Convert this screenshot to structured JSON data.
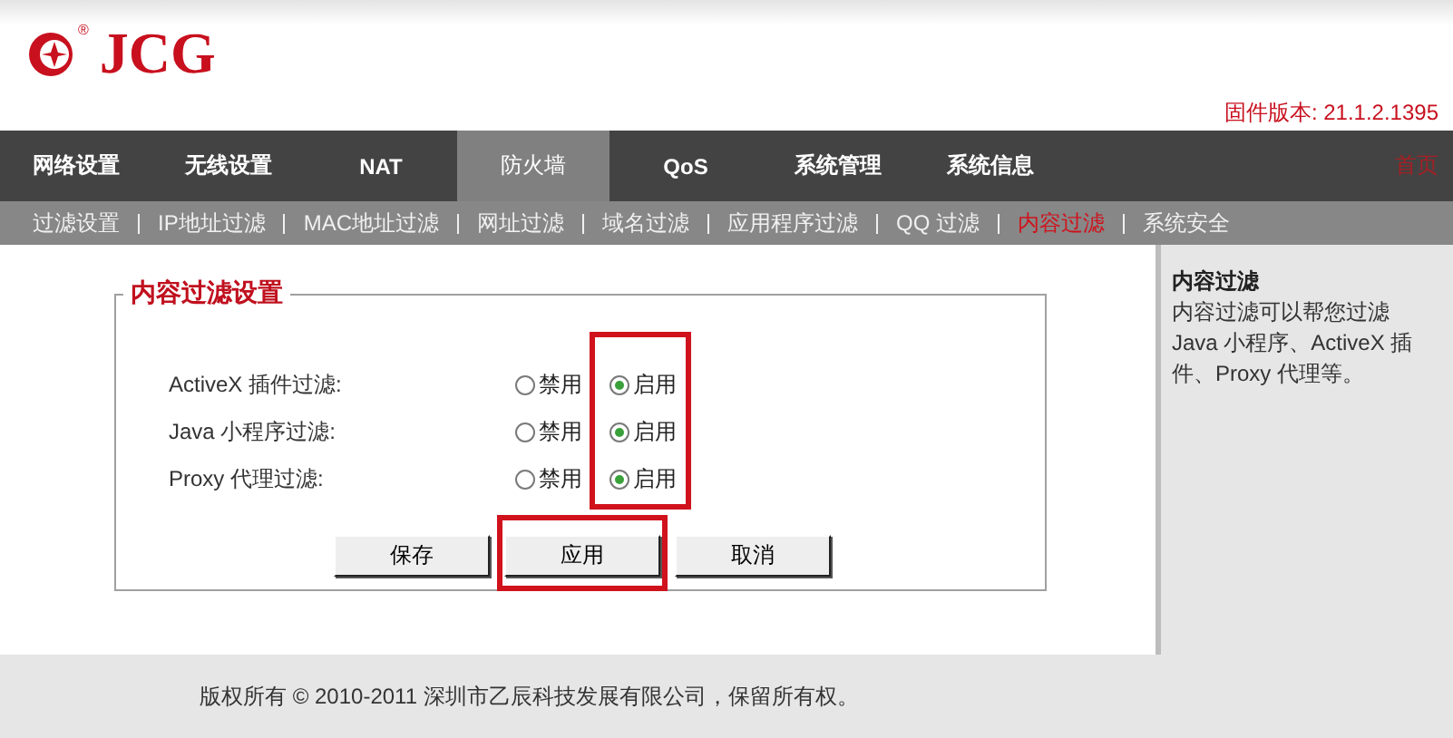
{
  "header": {
    "logo_text": "JCG",
    "logo_mark": "®",
    "firmware": "固件版本: 21.1.2.1395"
  },
  "main_nav": {
    "items": [
      {
        "label": "网络设置",
        "selected": false
      },
      {
        "label": "无线设置",
        "selected": false
      },
      {
        "label": "NAT",
        "selected": false
      },
      {
        "label": "防火墙",
        "selected": true
      },
      {
        "label": "QoS",
        "selected": false
      },
      {
        "label": "系统管理",
        "selected": false
      },
      {
        "label": "系统信息",
        "selected": false
      }
    ],
    "home_link": "首页"
  },
  "sub_nav": {
    "items": [
      {
        "label": "过滤设置",
        "selected": false
      },
      {
        "label": "IP地址过滤",
        "selected": false
      },
      {
        "label": "MAC地址过滤",
        "selected": false
      },
      {
        "label": "网址过滤",
        "selected": false
      },
      {
        "label": "域名过滤",
        "selected": false
      },
      {
        "label": "应用程序过滤",
        "selected": false
      },
      {
        "label": "QQ 过滤",
        "selected": false
      },
      {
        "label": "内容过滤",
        "selected": true
      },
      {
        "label": "系统安全",
        "selected": false
      }
    ]
  },
  "form": {
    "title": "内容过滤设置",
    "enable_column_highlighted": true,
    "rows": [
      {
        "label": "ActiveX 插件过滤:",
        "options": [
          {
            "label": "禁用",
            "selected": false
          },
          {
            "label": "启用",
            "selected": true
          }
        ]
      },
      {
        "label": "Java 小程序过滤:",
        "options": [
          {
            "label": "禁用",
            "selected": false
          },
          {
            "label": "启用",
            "selected": true
          }
        ]
      },
      {
        "label": "Proxy 代理过滤:",
        "options": [
          {
            "label": "禁用",
            "selected": false
          },
          {
            "label": "启用",
            "selected": true
          }
        ]
      }
    ],
    "buttons": [
      {
        "label": "保存",
        "highlighted": false
      },
      {
        "label": "应用",
        "highlighted": true
      },
      {
        "label": "取消",
        "highlighted": false
      }
    ]
  },
  "help": {
    "title": "内容过滤",
    "text": "内容过滤可以帮您过滤Java 小程序、ActiveX 插件、Proxy 代理等。"
  },
  "footer": {
    "text": "版权所有 © 2010-2011 深圳市乙辰科技发展有限公司，保留所有权。"
  }
}
